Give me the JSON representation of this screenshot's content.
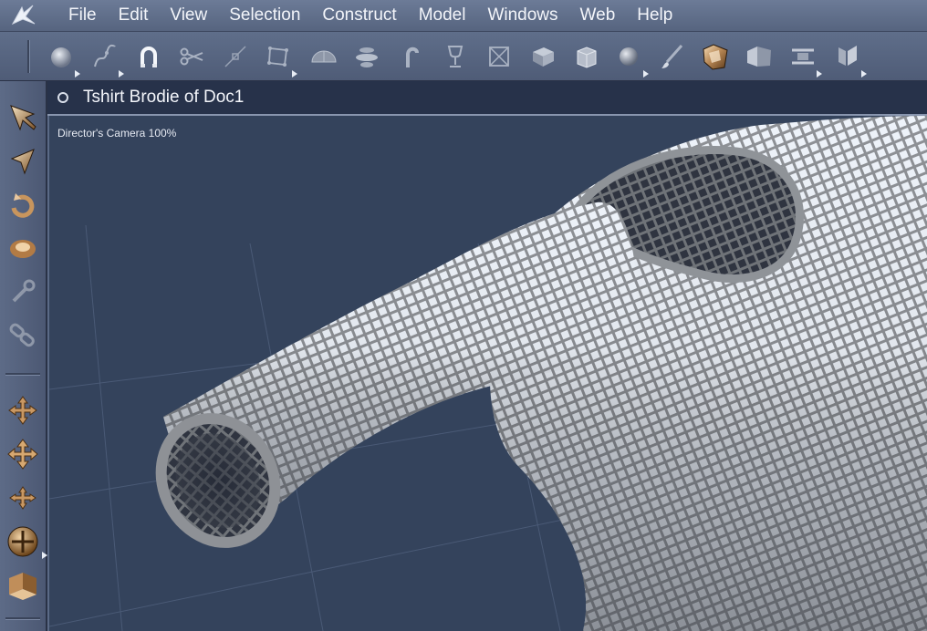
{
  "menubar": {
    "items": [
      "File",
      "Edit",
      "View",
      "Selection",
      "Construct",
      "Model",
      "Windows",
      "Web",
      "Help"
    ]
  },
  "toolbar": {
    "tools": [
      {
        "name": "sphere-icon"
      },
      {
        "name": "bezier-path-icon"
      },
      {
        "name": "magnet-icon"
      },
      {
        "name": "scissors-icon"
      },
      {
        "name": "point-tool-icon"
      },
      {
        "name": "box-edit-icon"
      },
      {
        "name": "half-dome-icon"
      },
      {
        "name": "lathe-icon"
      },
      {
        "name": "sweep-icon"
      },
      {
        "name": "goblet-icon"
      },
      {
        "name": "square-cross-icon"
      },
      {
        "name": "cube-icon"
      },
      {
        "name": "package-icon"
      },
      {
        "name": "shading-sphere-icon"
      },
      {
        "name": "brush-icon"
      },
      {
        "name": "shirt-modeler-icon"
      },
      {
        "name": "plane-panel-icon"
      },
      {
        "name": "tape-icon"
      },
      {
        "name": "bracket-icon"
      }
    ]
  },
  "leftbar": {
    "tools": [
      "select-arrow-icon",
      "move-arrow-icon",
      "rotate-icon",
      "scale-ring-icon",
      "wrench-icon",
      "link-icon",
      "move-xy-icon",
      "move-xz-icon",
      "move-yz-icon",
      "trackball-icon",
      "ground-plane-icon"
    ]
  },
  "document": {
    "title": "Tshirt  Brodie of Doc1"
  },
  "viewport": {
    "camera_label": "Director's Camera 100%"
  },
  "colors": {
    "chrome": "#5b6a86",
    "viewport_bg": "#34435c",
    "title_bg": "#27324a",
    "mesh_light": "#e8eef7",
    "mesh_shade": "#8c8f94"
  }
}
